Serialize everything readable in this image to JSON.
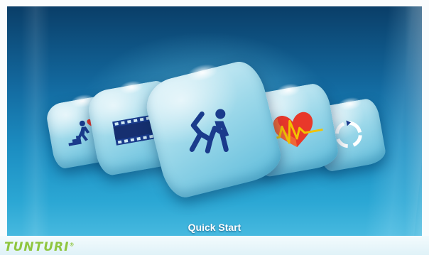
{
  "carousel": {
    "selected_label": "Quick Start",
    "items": [
      {
        "icon": "hill-climb-heart-icon"
      },
      {
        "icon": "film-strip-icon"
      },
      {
        "icon": "quick-start-runner-icon",
        "selected": true
      },
      {
        "icon": "heart-rate-icon"
      },
      {
        "icon": "circular-arrows-icon"
      }
    ]
  },
  "footer": {
    "brand": "TUNTURI",
    "registered_mark": "®",
    "brand_color": "#8fc640"
  },
  "colors": {
    "background_top": "#0a3e68",
    "background_bottom": "#47b9df",
    "icon_blue": "#1a3b8c",
    "heart_red": "#e8382a"
  }
}
